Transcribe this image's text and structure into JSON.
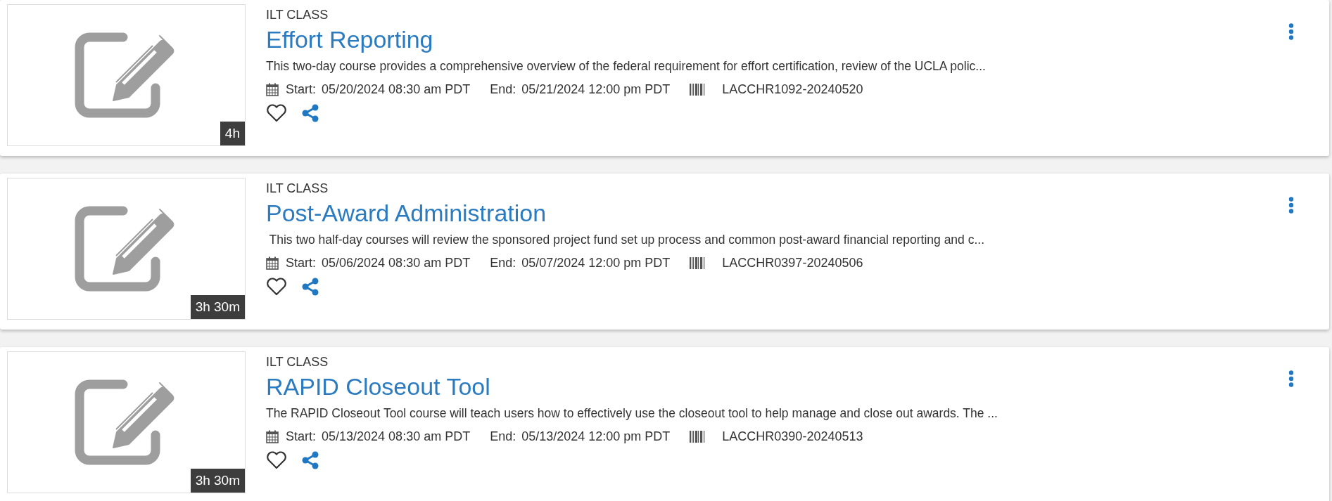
{
  "courses": [
    {
      "type": "ILT CLASS",
      "title": "Effort Reporting",
      "description": "This two-day course provides a comprehensive overview of the federal requirement for effort certification, review of the UCLA polic...",
      "start_label": "Start:",
      "start": "05/20/2024 08:30 am PDT",
      "end_label": "End:",
      "end": "05/21/2024 12:00 pm PDT",
      "code": "LACCHR1092-20240520",
      "duration": "4h",
      "favorite": false
    },
    {
      "type": "ILT CLASS",
      "title": "Post-Award Administration",
      "description": " This two half-day courses will review the sponsored project fund set up process and common post-award financial reporting and c...",
      "start_label": "Start:",
      "start": "05/06/2024 08:30 am PDT",
      "end_label": "End:",
      "end": "05/07/2024 12:00 pm PDT",
      "code": "LACCHR0397-20240506",
      "duration": "3h 30m",
      "favorite": false
    },
    {
      "type": "ILT CLASS",
      "title": "RAPID Closeout Tool",
      "description": "The RAPID Closeout Tool course will teach users how to effectively use the closeout tool to help manage and close out awards. The ...",
      "start_label": "Start:",
      "start": "05/13/2024 08:30 am PDT",
      "end_label": "End:",
      "end": "05/13/2024 12:00 pm PDT",
      "code": "LACCHR0390-20240513",
      "duration": "3h 30m",
      "favorite": false
    }
  ]
}
